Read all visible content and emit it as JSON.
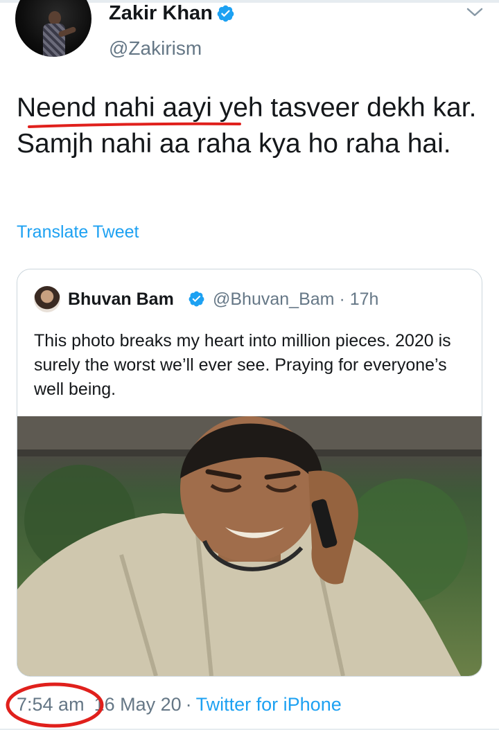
{
  "tweet": {
    "author_name": "Zakir Khan",
    "author_handle": "@Zakirism",
    "text": "Neend nahi aayi yeh tasveer dekh kar. Samjh nahi aa raha kya ho raha hai.",
    "translate_label": "Translate Tweet",
    "time": "7:54 am",
    "date": "16 May 20",
    "separator": "·",
    "source": "Twitter for iPhone"
  },
  "quoted_tweet": {
    "author_name": "Bhuvan Bam",
    "author_handle": "@Bhuvan_Bam",
    "separator": "·",
    "age": "17h",
    "text": "This photo breaks my heart into million pieces. 2020 is surely the worst we’ll ever see. Praying for everyone’s well being."
  },
  "icons": {
    "verified": "verified-badge-icon",
    "menu": "chevron-down-icon"
  },
  "colors": {
    "link": "#1da1f2",
    "secondary_text": "#657786",
    "annotation": "#e0201c"
  }
}
